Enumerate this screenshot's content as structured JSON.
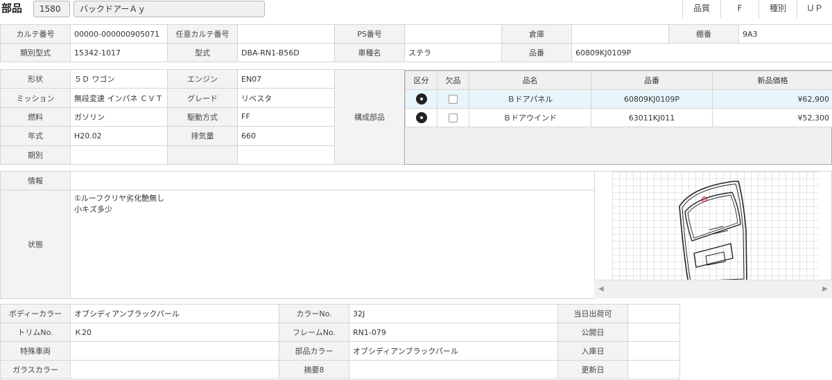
{
  "header": {
    "title": "部品",
    "code": "1580",
    "part_name": "バックドアーＡｙ",
    "quality_label": "品質",
    "quality_value": "F",
    "type_label": "種別",
    "type_value": "ＵＰ"
  },
  "row1": {
    "karte_label": "カルテ番号",
    "karte_value": "00000-000000905071",
    "nini_label": "任意カルテ番号",
    "nini_value": "",
    "ps_label": "PS番号",
    "ps_value": "",
    "souko_label": "倉庫",
    "souko_value": "",
    "tana_label": "棚番",
    "tana_value": "9A3"
  },
  "row2": {
    "ruibetsu_label": "類別型式",
    "ruibetsu_value": "15342-1017",
    "katashiki_label": "型式",
    "katashiki_value": "DBA-RN1-B56D",
    "shamei_label": "車種名",
    "shamei_value": "ステラ",
    "hinban_label": "品番",
    "hinban_value": "60809KJ0109P"
  },
  "spec": {
    "shape_label": "形状",
    "shape_value": "５Ｄ ワゴン",
    "engine_label": "エンジン",
    "engine_value": "EN07",
    "mission_label": "ミッション",
    "mission_value": "無段変速 インパネ ＣＶＴ",
    "grade_label": "グレード",
    "grade_value": "リベスタ",
    "fuel_label": "燃料",
    "fuel_value": "ガソリン",
    "drive_label": "駆動方式",
    "drive_value": "FF",
    "year_label": "年式",
    "year_value": "H20.02",
    "displacement_label": "排気量",
    "displacement_value": "660",
    "period_label": "期別",
    "period_value": "",
    "components_label": "構成部品"
  },
  "parts_grid": {
    "headers": [
      "区分",
      "欠品",
      "品名",
      "品番",
      "新品価格"
    ],
    "rows": [
      {
        "name": "Ｂドアパネル",
        "number": "60809KJ0109P",
        "price": "¥62,900"
      },
      {
        "name": "Ｂドアウインド",
        "number": "63011KJ011",
        "price": "¥52,300"
      }
    ]
  },
  "info": {
    "info_label": "情報",
    "info_value": "",
    "status_label": "状態",
    "status_line1": "①ルーフクリヤ劣化艶無し",
    "status_line2": "小キズ多少"
  },
  "bottom": {
    "body_color_label": "ボディーカラー",
    "body_color_value": "オブシディアンブラックパール",
    "color_no_label": "カラーNo.",
    "color_no_value": "32J",
    "shipping_label": "当日出荷可",
    "shipping_value": "",
    "trim_label": "トリムNo.",
    "trim_value": "Ｋ20",
    "frame_label": "フレームNo.",
    "frame_value": "RN1-079",
    "public_label": "公開日",
    "public_value": "",
    "special_label": "特殊車両",
    "special_value": "",
    "part_color_label": "部品カラー",
    "part_color_value": "オブシディアンブラックパール",
    "arrival_label": "入庫日",
    "arrival_value": "",
    "glass_label": "ガラスカラー",
    "glass_value": "",
    "summary_label": "摘要8",
    "summary_value": "",
    "updated_label": "更新日",
    "updated_value": ""
  },
  "icons": {
    "category": "disc-icon",
    "missing": "checkbox-icon",
    "scroll_left": "triangle-left-icon",
    "scroll_right": "triangle-right-icon"
  },
  "colors": {
    "label_bg": "#f3f3f3",
    "border": "#d4d4d4",
    "selected_row": "#e8f6fb"
  }
}
